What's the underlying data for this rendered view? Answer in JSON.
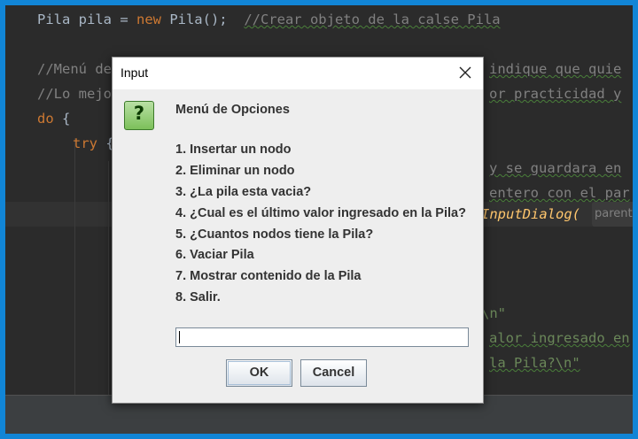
{
  "editor": {
    "line1_type": "Pila pila = ",
    "line1_new": "new",
    "line1_ctor": " Pila();",
    "line1_comment": "//Crear objeto de la calse Pila",
    "line2_left": "//Menú de",
    "line2_right": "indique que quie",
    "line3_left": "//Lo mejo",
    "line3_right": "or practicidad y",
    "line4_kw": "do",
    "line4_rest": " {",
    "line5_kw": "try",
    "line5_rest": " {",
    "line6_right": "y se guardara en",
    "line7_right": "entero con el par",
    "line8_method": "InputDialog(",
    "line8_hint": "parent",
    "line12_str": "\\n\"",
    "line13_right": "alor ingresado en",
    "line14_right": "la Pila?\\n\""
  },
  "dialog": {
    "title": "Input",
    "heading": "Menú de Opciones",
    "options": [
      "1. Insertar un nodo",
      "2. Eliminar un nodo",
      "3. ¿La pila esta vacia?",
      "4. ¿Cual es el último valor ingresado en la Pila?",
      "5. ¿Cuantos nodos tiene la Pila?",
      "6. Vaciar Pila",
      "7. Mostrar contenido de la Pila",
      "8. Salir."
    ],
    "input_value": "",
    "ok_label": "OK",
    "cancel_label": "Cancel"
  },
  "colors": {
    "border": "#1185d6",
    "editor_bg": "#2b2b2b",
    "keyword": "#cc7832",
    "comment": "#808080",
    "string": "#6a8759",
    "method": "#ffc66d"
  },
  "icons": {
    "question": "question-icon",
    "close": "close-icon"
  }
}
